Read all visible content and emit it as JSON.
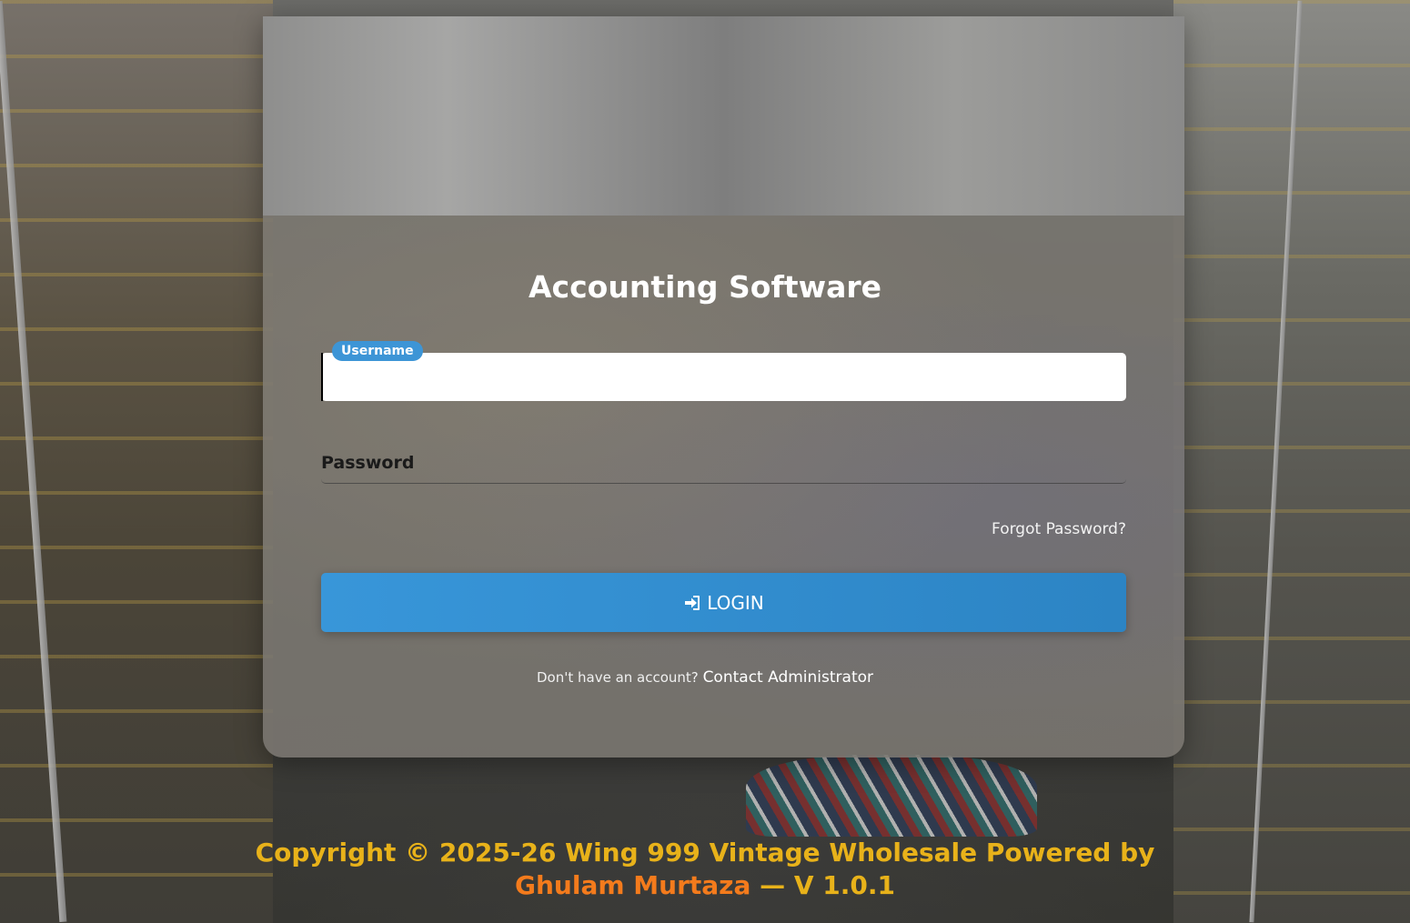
{
  "app": {
    "title": "Accounting Software"
  },
  "form": {
    "username_label": "Username",
    "username_value": "",
    "password_label": "Password",
    "password_value": "",
    "forgot_password": "Forgot Password?",
    "login_label": "LOGIN",
    "login_icon": "sign-in-icon",
    "signup_prompt": "Don't have an account?",
    "signup_link": "Contact Administrator"
  },
  "footer": {
    "line1": "Copyright © 2025-26 Wing 999 Vintage Wholesale Powered by",
    "author": "Ghulam Murtaza",
    "version": "— V 1.0.1"
  },
  "colors": {
    "accent": "#3896d9",
    "footer_text": "#e8b21a",
    "footer_author": "#f47b1c"
  }
}
